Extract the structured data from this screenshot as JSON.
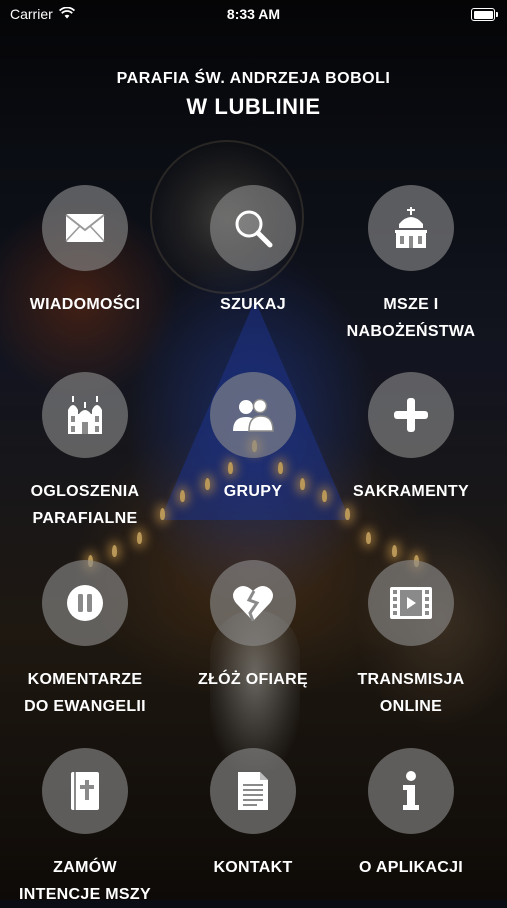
{
  "status_bar": {
    "carrier": "Carrier",
    "time": "8:33 AM"
  },
  "header": {
    "subtitle": "PARAFIA ŚW. ANDRZEJA BOBOLI",
    "title": "W LUBLINIE"
  },
  "menu": [
    {
      "id": "wiadomosci",
      "icon": "envelope-icon",
      "lines": [
        "WIADOMOŚCI"
      ]
    },
    {
      "id": "szukaj",
      "icon": "search-icon",
      "lines": [
        "SZUKAJ"
      ]
    },
    {
      "id": "msze",
      "icon": "church-icon",
      "lines": [
        "MSZE I",
        "NABOŻEŃSTWA"
      ]
    },
    {
      "id": "ogloszenia",
      "icon": "basilica-icon",
      "lines": [
        "OGLOSZENIA",
        "PARAFIALNE"
      ]
    },
    {
      "id": "grupy",
      "icon": "group-icon",
      "lines": [
        "GRUPY"
      ]
    },
    {
      "id": "sakramenty",
      "icon": "plus-icon",
      "lines": [
        "SAKRAMENTY"
      ]
    },
    {
      "id": "komentarze",
      "icon": "pause-icon",
      "lines": [
        "KOMENTARZE",
        "DO EWANGELII"
      ]
    },
    {
      "id": "ofiara",
      "icon": "broken-heart-icon",
      "lines": [
        "ZŁÓŻ OFIARĘ"
      ]
    },
    {
      "id": "transmisja",
      "icon": "film-icon",
      "lines": [
        "TRANSMISJA",
        "ONLINE"
      ]
    },
    {
      "id": "intencje",
      "icon": "bible-icon",
      "lines": [
        "ZAMÓW",
        "INTENCJE MSZY"
      ]
    },
    {
      "id": "kontakt",
      "icon": "document-icon",
      "lines": [
        "KONTAKT"
      ]
    },
    {
      "id": "o-aplikacji",
      "icon": "info-icon",
      "lines": [
        "O APLIKACJI"
      ]
    }
  ]
}
